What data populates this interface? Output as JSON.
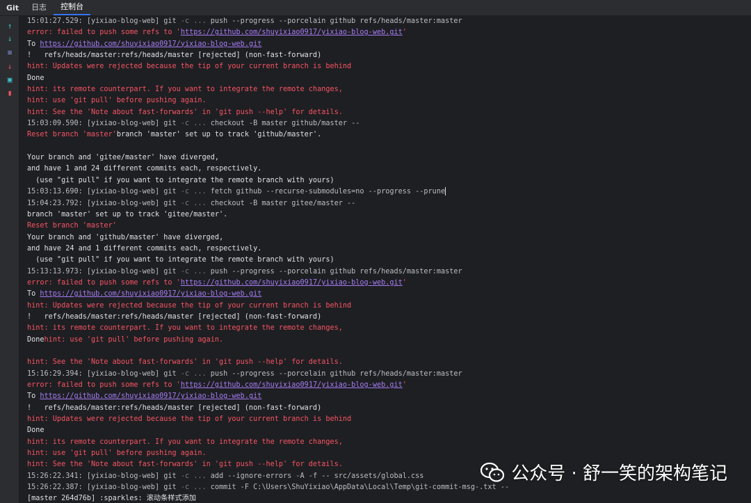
{
  "tabbar": {
    "title": "Git",
    "tabs": [
      {
        "label": "日志"
      },
      {
        "label": "控制台"
      }
    ]
  },
  "toolstrip": [
    {
      "icon": "arrow-up-icon",
      "glyph": "↑",
      "color": "#3fc1c9"
    },
    {
      "icon": "arrow-down-icon",
      "glyph": "↓",
      "color": "#3fc1c9"
    },
    {
      "icon": "soft-wrap-icon",
      "glyph": "≡",
      "color": "#8e9cf5"
    },
    {
      "icon": "scroll-to-end-icon",
      "glyph": "⇓",
      "color": "#f75464"
    },
    {
      "icon": "print-icon",
      "glyph": "▣",
      "color": "#3fc1c9"
    },
    {
      "icon": "clear-trash-icon",
      "glyph": "▮",
      "color": "#f75464"
    }
  ],
  "colors": {
    "error": "#f75464",
    "link": "#a57cf5",
    "text": "#dfe1e5",
    "accent": "#3574f0"
  },
  "console": {
    "lines": [
      [
        {
          "t": "cmd",
          "s": "15:01:27.529: [yixiao-blog-web] git "
        },
        {
          "t": "dim",
          "s": "-c ... "
        },
        {
          "t": "cmd",
          "s": "push --progress --porcelain github refs/heads/master:master"
        }
      ],
      [
        {
          "t": "err",
          "s": "error: failed to push some refs to '"
        },
        {
          "t": "link",
          "s": "https://github.com/shuyixiao0917/yixiao-blog-web.git"
        },
        {
          "t": "err",
          "s": "'"
        }
      ],
      [
        {
          "t": "plain",
          "s": "To "
        },
        {
          "t": "link",
          "s": "https://github.com/shuyixiao0917/yixiao-blog-web.git"
        }
      ],
      [
        {
          "t": "plain",
          "s": "!   refs/heads/master:refs/heads/master [rejected] (non-fast-forward)"
        }
      ],
      [
        {
          "t": "err",
          "s": "hint: Updates were rejected because the tip of your current branch is behind"
        }
      ],
      [
        {
          "t": "plain",
          "s": "Done"
        }
      ],
      [
        {
          "t": "err",
          "s": "hint: its remote counterpart. If you want to integrate the remote changes,"
        }
      ],
      [
        {
          "t": "err",
          "s": "hint: use 'git pull' before pushing again."
        }
      ],
      [
        {
          "t": "err",
          "s": "hint: See the 'Note about fast-forwards' in 'git push --help' for details."
        }
      ],
      [
        {
          "t": "cmd",
          "s": "15:03:09.590: [yixiao-blog-web] git "
        },
        {
          "t": "dim",
          "s": "-c ... "
        },
        {
          "t": "cmd",
          "s": "checkout -B master github/master --"
        }
      ],
      [
        {
          "t": "err",
          "s": "Reset branch 'master'"
        },
        {
          "t": "plain",
          "s": "branch 'master' set up to track 'github/master'."
        }
      ],
      [
        {
          "t": "plain",
          "s": ""
        }
      ],
      [
        {
          "t": "plain",
          "s": "Your branch and 'gitee/master' have diverged,"
        }
      ],
      [
        {
          "t": "plain",
          "s": "and have 1 and 24 different commits each, respectively."
        }
      ],
      [
        {
          "t": "plain",
          "s": "  (use \"git pull\" if you want to integrate the remote branch with yours)"
        }
      ],
      [
        {
          "t": "cmd",
          "s": "15:03:13.690: [yixiao-blog-web] git "
        },
        {
          "t": "dim",
          "s": "-c ... "
        },
        {
          "t": "cmd",
          "s": "fetch github --recurse-submodules=no --progress --prune"
        },
        {
          "t": "caret",
          "s": ""
        }
      ],
      [
        {
          "t": "cmd",
          "s": "15:04:23.792: [yixiao-blog-web] git "
        },
        {
          "t": "dim",
          "s": "-c ... "
        },
        {
          "t": "cmd",
          "s": "checkout -B master gitee/master --"
        }
      ],
      [
        {
          "t": "plain",
          "s": "branch 'master' set up to track 'gitee/master'."
        }
      ],
      [
        {
          "t": "err",
          "s": "Reset branch 'master'"
        }
      ],
      [
        {
          "t": "plain",
          "s": "Your branch and 'github/master' have diverged,"
        }
      ],
      [
        {
          "t": "plain",
          "s": "and have 24 and 1 different commits each, respectively."
        }
      ],
      [
        {
          "t": "plain",
          "s": "  (use \"git pull\" if you want to integrate the remote branch with yours)"
        }
      ],
      [
        {
          "t": "cmd",
          "s": "15:13:13.973: [yixiao-blog-web] git "
        },
        {
          "t": "dim",
          "s": "-c ... "
        },
        {
          "t": "cmd",
          "s": "push --progress --porcelain github refs/heads/master:master"
        }
      ],
      [
        {
          "t": "err",
          "s": "error: failed to push some refs to '"
        },
        {
          "t": "link",
          "s": "https://github.com/shuyixiao0917/yixiao-blog-web.git"
        },
        {
          "t": "err",
          "s": "'"
        }
      ],
      [
        {
          "t": "plain",
          "s": "To "
        },
        {
          "t": "link",
          "s": "https://github.com/shuyixiao0917/yixiao-blog-web.git"
        }
      ],
      [
        {
          "t": "err",
          "s": "hint: Updates were rejected because the tip of your current branch is behind"
        }
      ],
      [
        {
          "t": "plain",
          "s": "!   refs/heads/master:refs/heads/master [rejected] (non-fast-forward)"
        }
      ],
      [
        {
          "t": "err",
          "s": "hint: its remote counterpart. If you want to integrate the remote changes,"
        }
      ],
      [
        {
          "t": "plain",
          "s": "Done"
        },
        {
          "t": "err",
          "s": "hint: use 'git pull' before pushing again."
        }
      ],
      [
        {
          "t": "plain",
          "s": ""
        }
      ],
      [
        {
          "t": "err",
          "s": "hint: See the 'Note about fast-forwards' in 'git push --help' for details."
        }
      ],
      [
        {
          "t": "cmd",
          "s": "15:16:29.394: [yixiao-blog-web] git "
        },
        {
          "t": "dim",
          "s": "-c ... "
        },
        {
          "t": "cmd",
          "s": "push --progress --porcelain github refs/heads/master:master"
        }
      ],
      [
        {
          "t": "err",
          "s": "error: failed to push some refs to '"
        },
        {
          "t": "link",
          "s": "https://github.com/shuyixiao0917/yixiao-blog-web.git"
        },
        {
          "t": "err",
          "s": "'"
        }
      ],
      [
        {
          "t": "plain",
          "s": "To "
        },
        {
          "t": "link",
          "s": "https://github.com/shuyixiao0917/yixiao-blog-web.git"
        }
      ],
      [
        {
          "t": "plain",
          "s": "!   refs/heads/master:refs/heads/master [rejected] (non-fast-forward)"
        }
      ],
      [
        {
          "t": "err",
          "s": "hint: Updates were rejected because the tip of your current branch is behind"
        }
      ],
      [
        {
          "t": "plain",
          "s": "Done"
        }
      ],
      [
        {
          "t": "err",
          "s": "hint: its remote counterpart. If you want to integrate the remote changes,"
        }
      ],
      [
        {
          "t": "err",
          "s": "hint: use 'git pull' before pushing again."
        }
      ],
      [
        {
          "t": "err",
          "s": "hint: See the 'Note about fast-forwards' in 'git push --help' for details."
        }
      ],
      [
        {
          "t": "cmd",
          "s": "15:26:22.341: [yixiao-blog-web] git "
        },
        {
          "t": "dim",
          "s": "-c ... "
        },
        {
          "t": "cmd",
          "s": "add --ignore-errors -A -f -- src/assets/global.css"
        }
      ],
      [
        {
          "t": "cmd",
          "s": "15:26:22.387: [yixiao-blog-web] git "
        },
        {
          "t": "dim",
          "s": "-c ... "
        },
        {
          "t": "cmd",
          "s": "commit -F C:\\Users\\ShuYixiao\\AppData\\Local\\Temp\\git-commit-msg-.txt --"
        }
      ],
      [
        {
          "t": "plain",
          "s": "[master 264d76b] :sparkles: 滚动条样式添加"
        }
      ]
    ]
  },
  "watermark": {
    "text": "公众号 · 舒一笑的架构笔记"
  }
}
